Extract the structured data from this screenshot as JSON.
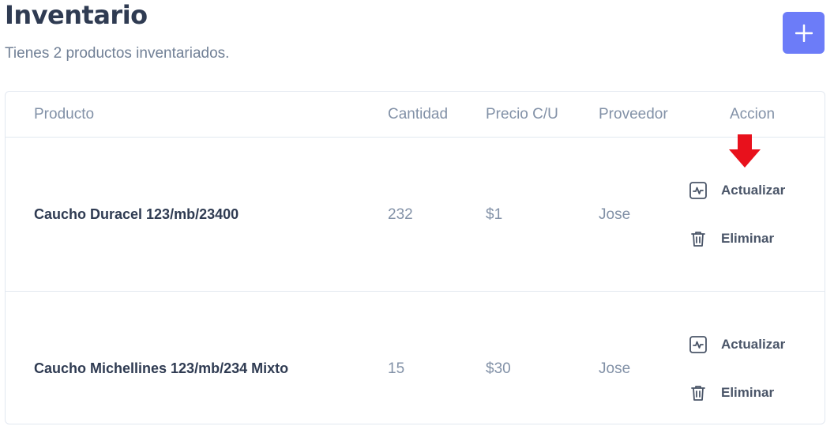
{
  "header": {
    "title": "Inventario",
    "subtitle": "Tienes 2 productos inventariados.",
    "add_button_symbol": "+"
  },
  "table": {
    "columns": [
      "Producto",
      "Cantidad",
      "Precio C/U",
      "Proveedor",
      "Accion"
    ],
    "rows": [
      {
        "producto": "Caucho Duracel 123/mb/23400",
        "cantidad": "232",
        "precio": "$1",
        "proveedor": "Jose",
        "actions": {
          "update": "Actualizar",
          "delete": "Eliminar"
        }
      },
      {
        "producto": "Caucho Michellines 123/mb/234 Mixto",
        "cantidad": "15",
        "precio": "$30",
        "proveedor": "Jose",
        "actions": {
          "update": "Actualizar",
          "delete": "Eliminar"
        }
      }
    ]
  },
  "colors": {
    "accent": "#6c7cf8",
    "title": "#2f3b52",
    "muted": "#8291a7",
    "border": "#e2e8f0",
    "annotation_arrow": "#e8111c"
  },
  "icons": {
    "add": "plus-icon",
    "update": "activity-chart-icon",
    "delete": "trash-icon",
    "annotation": "down-arrow-icon"
  }
}
